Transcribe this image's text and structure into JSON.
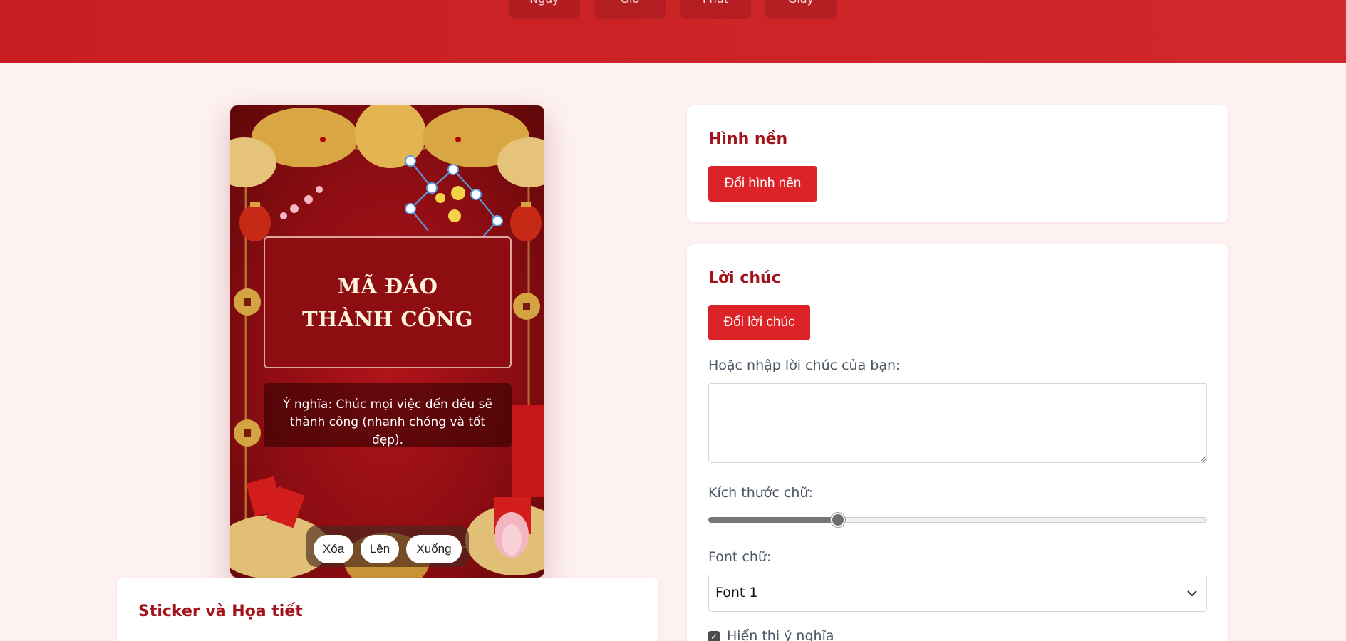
{
  "header": {
    "countdown_labels": [
      "Ngày",
      "Giờ",
      "Phút",
      "Giây"
    ]
  },
  "card": {
    "title": "MÃ ĐÁO THÀNH CÔNG",
    "meaning": "Ý nghĩa: Chúc mọi việc đến đều sẽ thành công (nhanh chóng và tốt đẹp).",
    "sticker_toolbar": {
      "delete_label": "Xóa",
      "up_label": "Lên",
      "down_label": "Xuống"
    }
  },
  "background_panel": {
    "title": "Hình nền",
    "change_button": "Đổi hình nền"
  },
  "wish_panel": {
    "title": "Lời chúc",
    "change_button": "Đổi lời chúc",
    "input_label": "Hoặc nhập lời chúc của bạn:",
    "input_value": "",
    "font_size_label": "Kích thước chữ:",
    "font_size_value": 0.26,
    "font_label": "Font chữ:",
    "font_selected": "Font 1",
    "show_meaning_label": "Hiển thị ý nghĩa",
    "show_meaning_checked": true
  },
  "sticker_panel": {
    "title": "Sticker và Họa tiết"
  },
  "colors": {
    "header_red": "#c81e22",
    "accent_red": "#dc2328",
    "title_red": "#a31218",
    "page_bg": "#fef1f1"
  }
}
